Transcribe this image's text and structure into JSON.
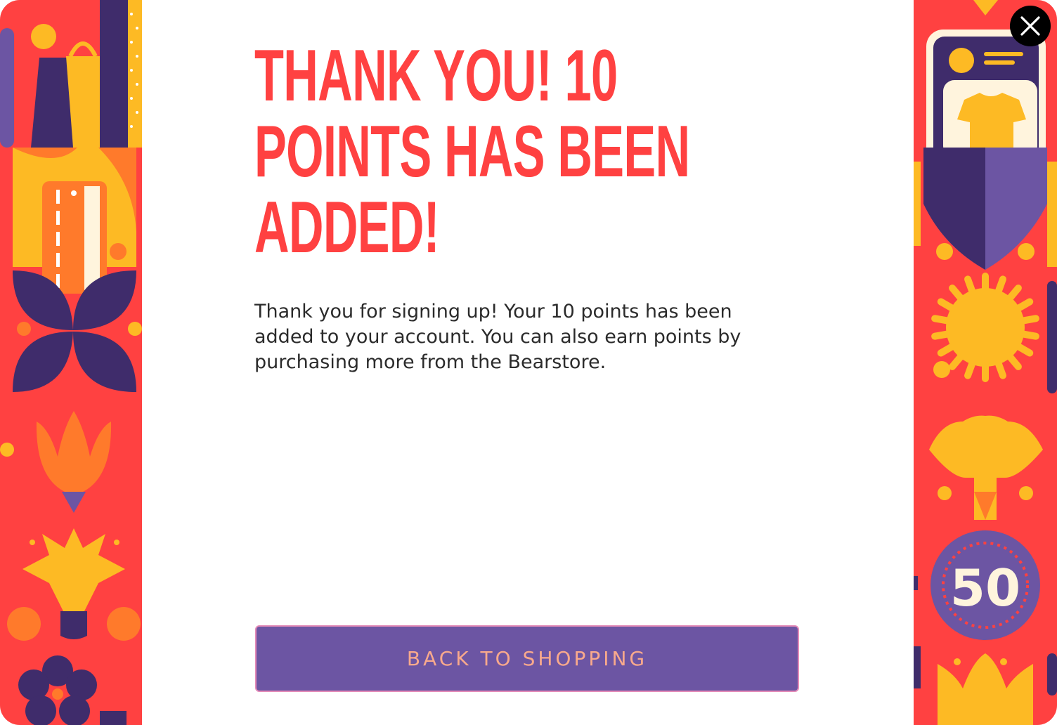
{
  "modal": {
    "heading": "THANK YOU! 10 POINTS HAS BEEN ADDED!",
    "body": "Thank you for signing up! Your 10 points has been added to your account. You can also earn points by purchasing more from the Bearstore.",
    "cta_label": "BACK TO SHOPPING",
    "close_icon": "close-icon"
  },
  "decor": {
    "badge_number": "50"
  },
  "colors": {
    "accent_red": "#FF4141",
    "button_purple": "#6C55A3",
    "button_text": "#F8A98C",
    "pattern_yellow": "#FDBA24",
    "pattern_orange": "#FF7A2B",
    "pattern_purple": "#3F2C6B"
  }
}
